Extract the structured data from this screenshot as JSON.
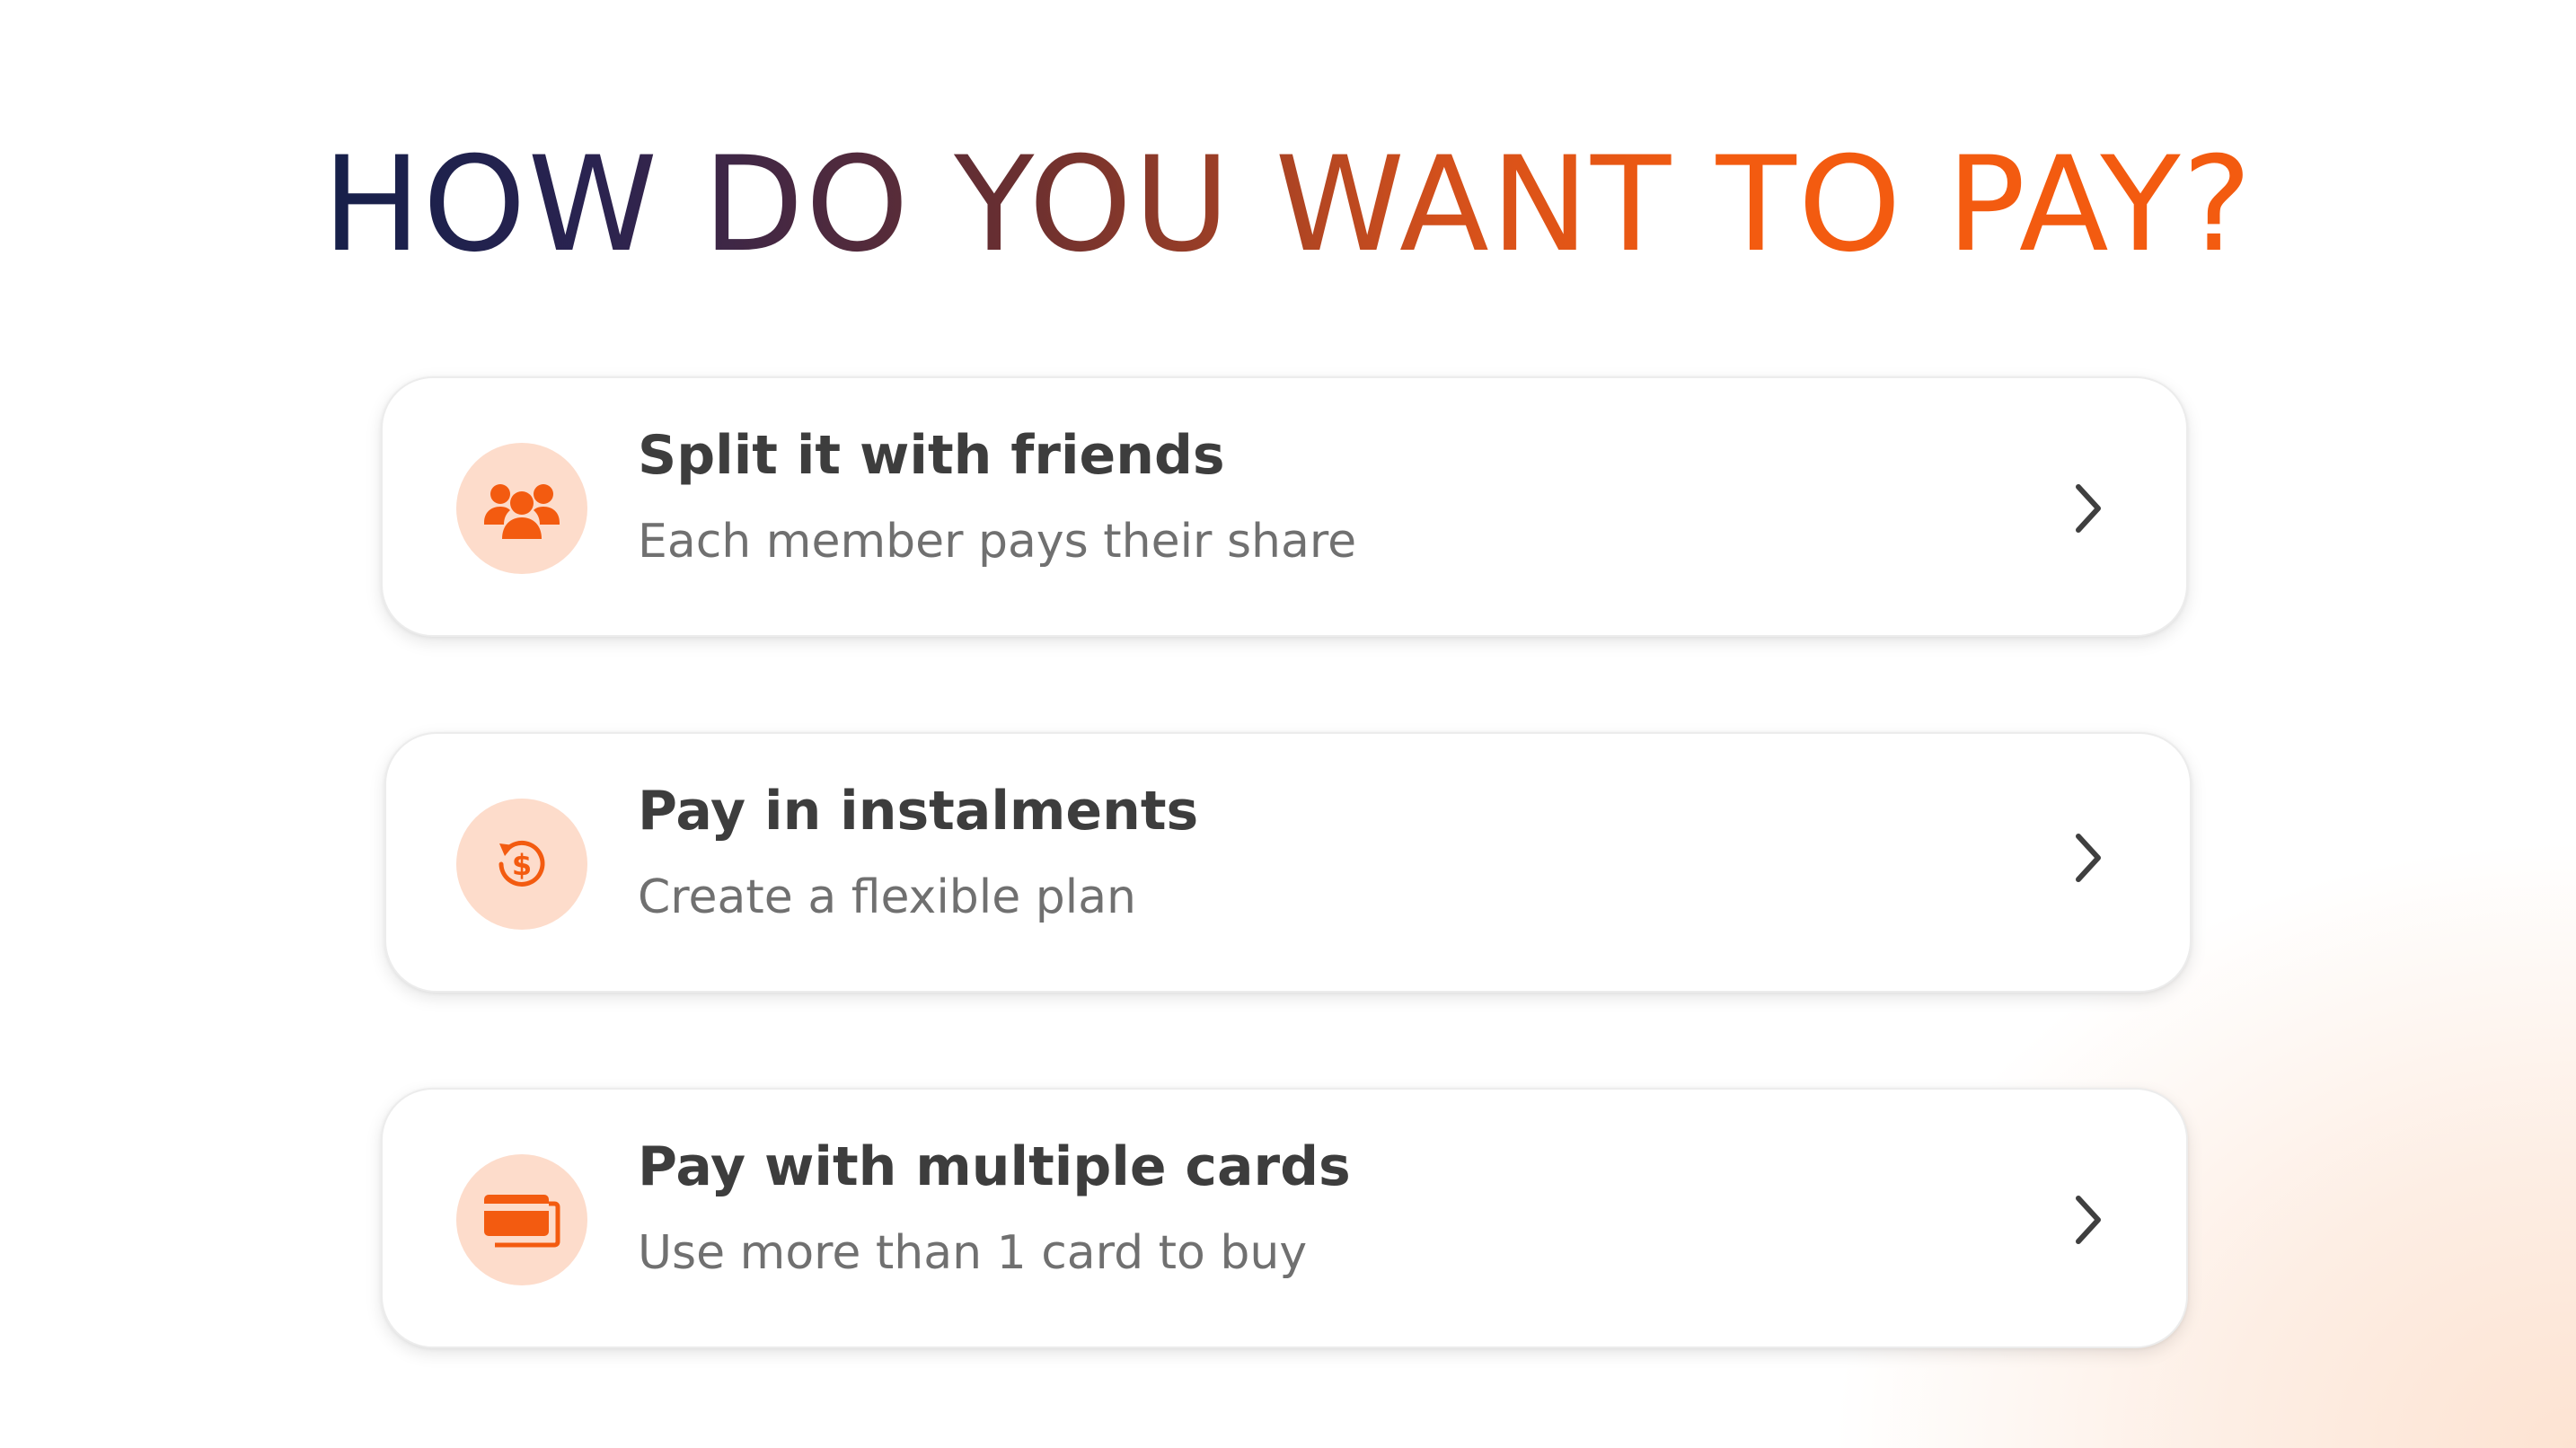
{
  "header": {
    "title": "HOW DO YOU WANT TO PAY?"
  },
  "options": [
    {
      "title": "Split it with friends",
      "subtitle": "Each member pays their share",
      "icon": "group-icon",
      "action_icon": "chevron-right-icon"
    },
    {
      "title": "Pay in instalments",
      "subtitle": "Create a flexible plan",
      "icon": "instalment-dollar-icon",
      "action_icon": "chevron-right-icon"
    },
    {
      "title": "Pay with multiple cards",
      "subtitle": "Use more than 1 card to buy",
      "icon": "credit-cards-icon",
      "action_icon": "chevron-right-icon"
    }
  ],
  "colors": {
    "accent": "#f35b10",
    "navy": "#16204a",
    "icon_bg": "#fddccb",
    "title_text": "#3d3d3d",
    "subtitle_text": "#707070"
  }
}
